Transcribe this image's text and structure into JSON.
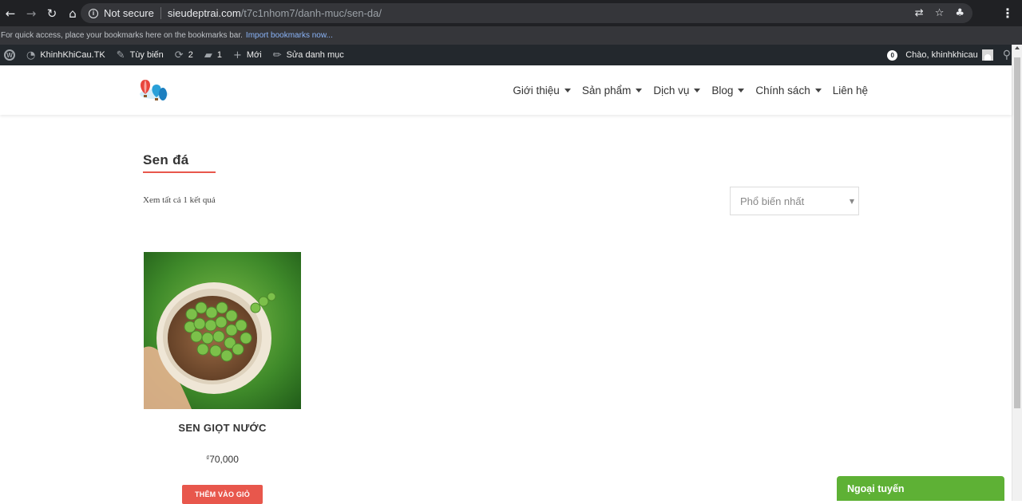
{
  "browser": {
    "security_label": "Not secure",
    "url_host": "sieudeptrai.com",
    "url_path": "/t7c1nhom7/danh-muc/sen-da/",
    "icons": [
      "back-arrow-icon",
      "forward-arrow-icon",
      "reload-icon",
      "home-icon",
      "info-icon",
      "translate-icon",
      "star-icon",
      "extension-icon",
      "menu-dots-icon"
    ]
  },
  "bookmarks": {
    "hint": "For quick access, place your bookmarks here on the bookmarks bar.",
    "import_link": "Import bookmarks now..."
  },
  "admin_bar": {
    "site_name": "KhinhKhiCau.TK",
    "customize": "Tùy biến",
    "updates_count": "2",
    "comments_count": "1",
    "new_label": "Mới",
    "edit_category": "Sửa danh mục",
    "notif_count": "0",
    "greeting": "Chào, khinhkhicau"
  },
  "site": {
    "nav": [
      {
        "label": "Giới thiệu",
        "has_dropdown": true
      },
      {
        "label": "Sản phẩm",
        "has_dropdown": true
      },
      {
        "label": "Dịch vụ",
        "has_dropdown": true
      },
      {
        "label": "Blog",
        "has_dropdown": true
      },
      {
        "label": "Chính sách",
        "has_dropdown": true
      },
      {
        "label": "Liên hệ",
        "has_dropdown": false
      }
    ]
  },
  "page": {
    "title": "Sen đá",
    "result_count": "Xem tất cả 1 kết quả",
    "sort_selected": "Phổ biến nhất"
  },
  "products": [
    {
      "name": "SEN GIỌT NƯỚC",
      "currency": "₫",
      "price": "70,000",
      "button_label": "THÊM VÀO GIỎ"
    }
  ],
  "chat": {
    "status": "Ngoại tuyến"
  },
  "colors": {
    "accent": "#e8574c",
    "chat_green": "#5eb135",
    "admin_bar": "#23282d",
    "browser_dark": "#202124"
  }
}
